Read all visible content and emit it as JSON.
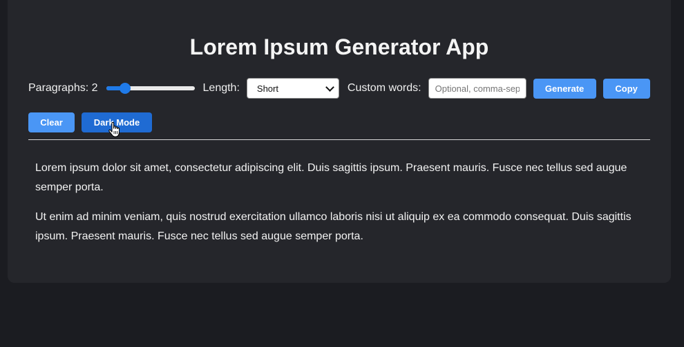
{
  "app": {
    "title": "Lorem Ipsum Generator App"
  },
  "controls": {
    "paragraphs_label": "Paragraphs: 2",
    "paragraphs_value": 2,
    "paragraphs_slider_fraction": 0.17,
    "length_label": "Length:",
    "length_selected": "Short",
    "custom_words_label": "Custom words:",
    "custom_words_placeholder": "Optional, comma-separated",
    "custom_words_value": ""
  },
  "buttons": {
    "generate": "Generate",
    "copy": "Copy",
    "clear": "Clear",
    "dark_mode": "Dark Mode"
  },
  "output": {
    "paragraphs": [
      "Lorem ipsum dolor sit amet, consectetur adipiscing elit. Duis sagittis ipsum. Praesent mauris. Fusce nec tellus sed augue semper porta.",
      "Ut enim ad minim veniam, quis nostrud exercitation ullamco laboris nisi ut aliquip ex ea commodo consequat. Duis sagittis ipsum. Praesent mauris. Fusce nec tellus sed augue semper porta."
    ]
  },
  "colors": {
    "page_background": "#1b1c21",
    "card_background": "#25262b",
    "button_primary": "#4a96f5",
    "button_dark_mode": "#1f6bd3",
    "slider_accent": "#1f7ae8"
  },
  "icons": {
    "select_arrow": "chevron-down-icon",
    "mouse_cursor": "hand-pointer-icon"
  }
}
